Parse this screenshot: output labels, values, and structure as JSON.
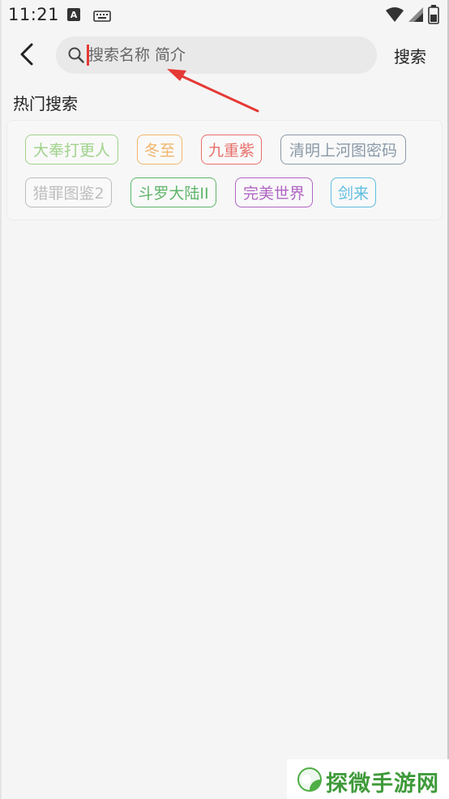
{
  "status_bar": {
    "time": "11:21",
    "notification_letter": "A",
    "icons": [
      "keyboard-icon",
      "wifi-icon",
      "signal-icon",
      "battery-icon"
    ]
  },
  "header": {
    "search_placeholder": "搜索名称 简介",
    "search_value": "",
    "search_button_label": "搜索"
  },
  "hot_search": {
    "title": "热门搜索",
    "tags": [
      {
        "label": "大奉打更人",
        "color": "#9fd28a"
      },
      {
        "label": "冬至",
        "color": "#f1b56a"
      },
      {
        "label": "九重紫",
        "color": "#e8706a"
      },
      {
        "label": "清明上河图密码",
        "color": "#8a9aa8"
      },
      {
        "label": "猎罪图鉴2",
        "color": "#bdbdbd"
      },
      {
        "label": "斗罗大陆II",
        "color": "#5fb56a"
      },
      {
        "label": "完美世界",
        "color": "#b065c4"
      },
      {
        "label": "剑来",
        "color": "#5fbde0"
      }
    ]
  },
  "annotation": {
    "color": "#e53935"
  },
  "watermark": {
    "text": "探微手游网",
    "color": "#3f9a3a"
  }
}
